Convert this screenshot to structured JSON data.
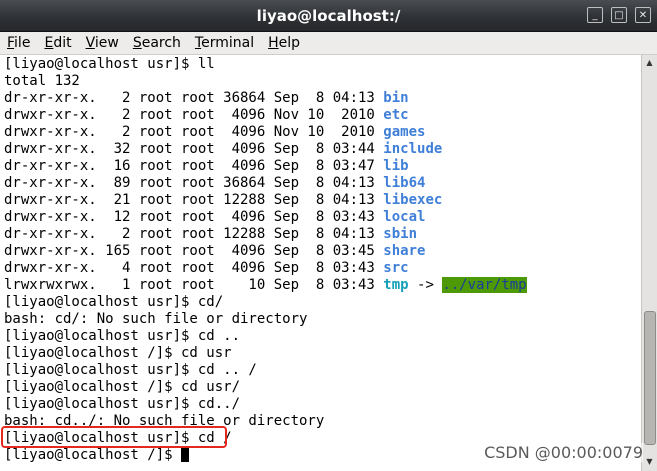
{
  "window": {
    "title": "liyao@localhost:/",
    "buttons": [
      "_",
      "□",
      "✕"
    ]
  },
  "menubar": [
    {
      "underline": "F",
      "rest": "ile"
    },
    {
      "underline": "E",
      "rest": "dit"
    },
    {
      "underline": "V",
      "rest": "iew"
    },
    {
      "underline": "S",
      "rest": "earch"
    },
    {
      "underline": "T",
      "rest": "erminal"
    },
    {
      "underline": "H",
      "rest": "elp"
    }
  ],
  "terminal": {
    "lines": [
      {
        "segments": [
          {
            "text": "[liyao@localhost usr]$ ll"
          }
        ]
      },
      {
        "segments": [
          {
            "text": "total 132"
          }
        ]
      },
      {
        "segments": [
          {
            "text": "dr-xr-xr-x.   2 root root 36864 Sep  8 04:13 "
          },
          {
            "text": "bin",
            "style": "blue"
          }
        ]
      },
      {
        "segments": [
          {
            "text": "drwxr-xr-x.   2 root root  4096 Nov 10  2010 "
          },
          {
            "text": "etc",
            "style": "blue"
          }
        ]
      },
      {
        "segments": [
          {
            "text": "drwxr-xr-x.   2 root root  4096 Nov 10  2010 "
          },
          {
            "text": "games",
            "style": "blue"
          }
        ]
      },
      {
        "segments": [
          {
            "text": "drwxr-xr-x.  32 root root  4096 Sep  8 03:44 "
          },
          {
            "text": "include",
            "style": "blue"
          }
        ]
      },
      {
        "segments": [
          {
            "text": "dr-xr-xr-x.  16 root root  4096 Sep  8 03:47 "
          },
          {
            "text": "lib",
            "style": "blue"
          }
        ]
      },
      {
        "segments": [
          {
            "text": "dr-xr-xr-x.  89 root root 36864 Sep  8 04:13 "
          },
          {
            "text": "lib64",
            "style": "blue"
          }
        ]
      },
      {
        "segments": [
          {
            "text": "drwxr-xr-x.  21 root root 12288 Sep  8 04:13 "
          },
          {
            "text": "libexec",
            "style": "blue"
          }
        ]
      },
      {
        "segments": [
          {
            "text": "drwxr-xr-x.  12 root root  4096 Sep  8 03:43 "
          },
          {
            "text": "local",
            "style": "blue"
          }
        ]
      },
      {
        "segments": [
          {
            "text": "dr-xr-xr-x.   2 root root 12288 Sep  8 04:13 "
          },
          {
            "text": "sbin",
            "style": "blue"
          }
        ]
      },
      {
        "segments": [
          {
            "text": "drwxr-xr-x. 165 root root  4096 Sep  8 03:45 "
          },
          {
            "text": "share",
            "style": "blue"
          }
        ]
      },
      {
        "segments": [
          {
            "text": "drwxr-xr-x.   4 root root  4096 Sep  8 03:43 "
          },
          {
            "text": "src",
            "style": "blue"
          }
        ]
      },
      {
        "segments": [
          {
            "text": "lrwxrwxrwx.   1 root root    10 Sep  8 03:43 "
          },
          {
            "text": "tmp",
            "style": "cyan"
          },
          {
            "text": " -> "
          },
          {
            "text": "../var/tmp",
            "style": "hl"
          }
        ]
      },
      {
        "segments": [
          {
            "text": "[liyao@localhost usr]$ cd/"
          }
        ]
      },
      {
        "segments": [
          {
            "text": "bash: cd/: No such file or directory"
          }
        ]
      },
      {
        "segments": [
          {
            "text": "[liyao@localhost usr]$ cd .."
          }
        ]
      },
      {
        "segments": [
          {
            "text": "[liyao@localhost /]$ cd usr"
          }
        ]
      },
      {
        "segments": [
          {
            "text": "[liyao@localhost usr]$ cd .. /"
          }
        ]
      },
      {
        "segments": [
          {
            "text": "[liyao@localhost /]$ cd usr/"
          }
        ]
      },
      {
        "segments": [
          {
            "text": "[liyao@localhost usr]$ cd../"
          }
        ]
      },
      {
        "segments": [
          {
            "text": "bash: cd../: No such file or directory"
          }
        ]
      },
      {
        "segments": [
          {
            "text": "[liyao@localhost usr]$ cd /"
          }
        ]
      },
      {
        "segments": [
          {
            "text": "[liyao@localhost /]$ "
          }
        ],
        "cursor": true
      }
    ]
  },
  "watermark": "CSDN @00:00:0079",
  "colors": {
    "dir": "#3f7fd8",
    "symlink": "#13a0b8",
    "link_target_bg": "#4e9a06",
    "annotation": "#e5281e"
  }
}
